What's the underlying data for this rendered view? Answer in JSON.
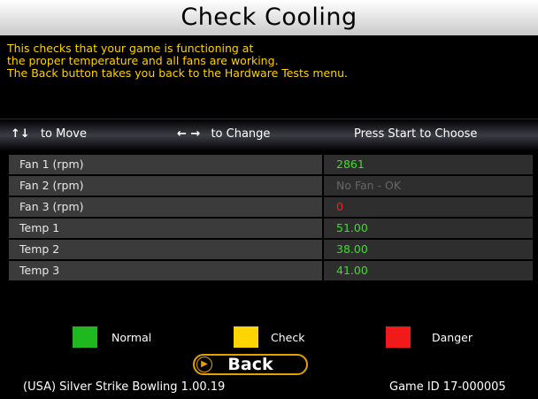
{
  "header": {
    "title": "Check Cooling"
  },
  "description": [
    "This checks that your game is functioning at",
    "the proper temperature and all fans are working.",
    "The Back button takes you back to the Hardware Tests menu."
  ],
  "nav": {
    "move": {
      "icon": "up-down-arrows-icon",
      "glyph": "↑↓",
      "label": "to Move"
    },
    "change": {
      "icon": "left-right-arrows-icon",
      "glyph": "← →",
      "label": "to Change"
    },
    "choose": {
      "label": "Press Start to Choose"
    }
  },
  "rows": [
    {
      "label": "Fan 1 (rpm)",
      "value": "2861",
      "status": "normal"
    },
    {
      "label": "Fan 2 (rpm)",
      "value": "No Fan - OK",
      "status": "none"
    },
    {
      "label": "Fan 3 (rpm)",
      "value": "0",
      "status": "danger"
    },
    {
      "label": "Temp 1",
      "value": "51.00",
      "status": "normal"
    },
    {
      "label": "Temp 2",
      "value": "38.00",
      "status": "normal"
    },
    {
      "label": "Temp 3",
      "value": "41.00",
      "status": "normal"
    }
  ],
  "legend": [
    {
      "label": "Normal",
      "color": "#1fb81f"
    },
    {
      "label": "Check",
      "color": "#ffd400"
    },
    {
      "label": "Danger",
      "color": "#f01a1a"
    }
  ],
  "back_button": {
    "label": "Back",
    "icon": "chevron-right-icon"
  },
  "footer": {
    "left": "(USA) Silver Strike Bowling 1.00.19",
    "right": "Game ID 17-000005"
  },
  "colors": {
    "title_bar": "#ffffff",
    "description_text": "#ffd200",
    "value_normal": "#31e61b",
    "value_danger": "#ff1a1a",
    "back_border": "#e3a200"
  }
}
